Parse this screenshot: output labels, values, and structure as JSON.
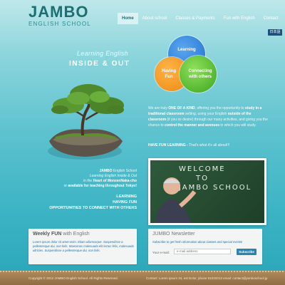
{
  "header": {
    "logo_main": "JAMBO",
    "logo_sub": "ENGLISH SCHOOL",
    "nav": [
      {
        "label": "Home"
      },
      {
        "label": "About school"
      },
      {
        "label": "Classes & Payments"
      },
      {
        "label": "Fun with English"
      },
      {
        "label": "Contact"
      }
    ],
    "lang_button": "日本語"
  },
  "hero": {
    "tagline_1": "Learning English",
    "tagline_2": "INSIDE & OUT",
    "circles": {
      "learning": "Learning",
      "fun": "Having Fun",
      "connecting": "Connecting with others"
    }
  },
  "intro": {
    "p1": "We are truly",
    "p1_bold": "ONE OF A KIND",
    "p2": ", offering you the opportunity to",
    "p2_bold": "study in a traditional classroom",
    "p3": " setting, using your English",
    "p3_bold": "outside of the classroom",
    "p4": " (if you so desire) through our many activities, and giving you the chance to",
    "p4_bold": "control the manner and avenues",
    "p5": " in which you will study.",
    "fun_bold": "HAVE FUN LEARNING -",
    "fun_rest": " That's what it's all about!!!"
  },
  "location": {
    "line1_bold": "JAMBO",
    "line1": " English School",
    "line2": "Learning English Inside & Out",
    "line3": "in the",
    "line3_bold": "Heart of MonzenNaka-cho",
    "line4": "or",
    "line4_bold": "available for teaching",
    "line4_bold2": " throughout Tokyo!"
  },
  "pillars": [
    "LEARNING",
    "HAVING FUN",
    "OPPORTUNITIES TO CONNECT WITH OTHERS"
  ],
  "photo": {
    "board_line1": "WELCOME",
    "board_line2": "TO",
    "board_line3": "JAMBO SCHOOL"
  },
  "weekly": {
    "title_bold": "Weekly FUN",
    "title_rest": " with English",
    "text": "Lorem ipsum dolor sit amet enim. Etiam ullamcorper. Suspendisse a pellentesque dui, non felis. Maecenas malesuada elit lectus felis, malesuada ultricies. Suspendisse a pellentesque dui, non felis."
  },
  "newsletter": {
    "title": "JUMBO Newsletter",
    "text": "Subscribe to get fresh information about classes and special events!",
    "email_label": "Your e-mail:",
    "email_placeholder": "e-mail address",
    "subscribe_label": "Subscribe"
  },
  "footer": {
    "copyright": "Copyright © 2012 JAMBO English School. All Rights Reserved.",
    "contact": "Contact: Lorem ipsum 34, est Dolor, phone 51033313 email: contact@jamboschool.jp"
  },
  "colors": {
    "accent": "#1d6f73",
    "learning": "#1f6fcd",
    "fun": "#ee8a12",
    "connecting": "#3ca51f",
    "subscribe": "#2b84ad"
  }
}
